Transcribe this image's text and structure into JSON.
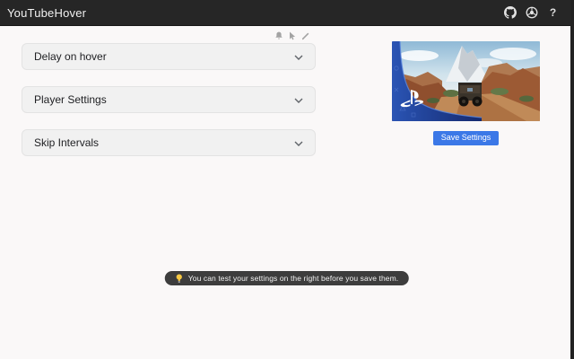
{
  "header": {
    "title": "YouTubeHover",
    "help_glyph": "?",
    "icons": [
      "github-icon",
      "webstore-icon",
      "help-icon"
    ]
  },
  "mini_toolbar": {
    "icons": [
      "bell-icon",
      "cursor-icon",
      "pencil-icon"
    ]
  },
  "sections": [
    {
      "label": "Delay on hover"
    },
    {
      "label": "Player Settings"
    },
    {
      "label": "Skip Intervals"
    }
  ],
  "preview": {
    "save_button": "Save Settings",
    "thumbnail": "uncharted-playstation-jeep-canyon-video"
  },
  "tooltip": {
    "icon": "lightbulb-icon",
    "text": "You can test your settings on the right before you save them."
  },
  "colors": {
    "header_bg": "#262626",
    "page_bg": "#faf8f8",
    "accent_blue": "#3b78e7",
    "tooltip_bg": "#3d3d3d",
    "bulb_yellow": "#f7c843",
    "ps_band_blue": "#1c3f9e"
  }
}
